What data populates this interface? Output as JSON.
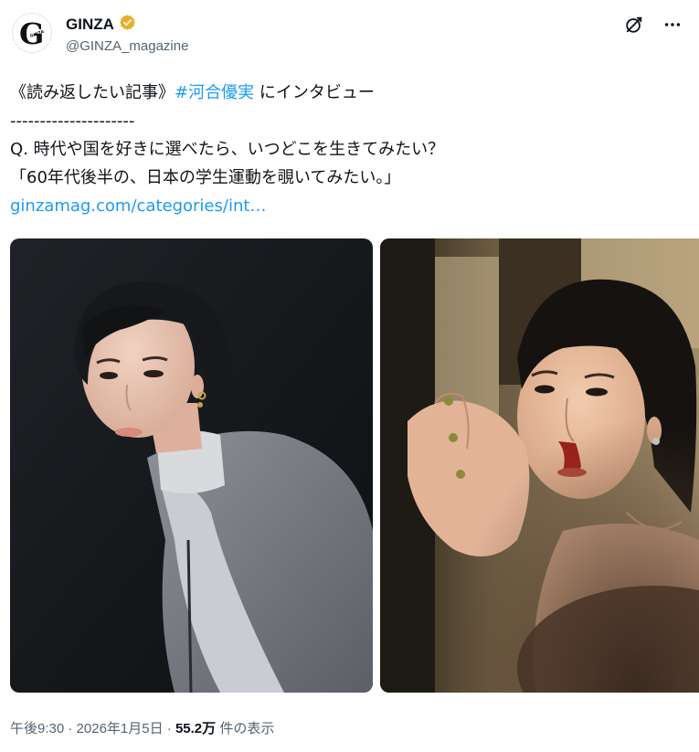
{
  "account": {
    "avatar_letter": "G",
    "avatar_wordmark": "GINZA",
    "display_name": "GINZA",
    "handle": "@GINZA_magazine",
    "verified_color": "#e8b02a"
  },
  "tweet": {
    "line1_prefix": "《読み返したい記事》",
    "hashtag": "#河合優実",
    "line1_suffix": " にインタビュー",
    "separator": "---------------------",
    "question": "Q. 時代や国を好きに選べたら、いつどこを生きてみたい？",
    "answer": "「60年代後半の、日本の学生運動を覗いてみたい。」",
    "link": "ginzamag.com/categories/int…"
  },
  "media": {
    "left_image": "portrait-photo",
    "right_image": "film-still-photo"
  },
  "meta": {
    "time": "午後9:30",
    "dot": " · ",
    "date": "2026年1月5日",
    "views_count": "55.2万",
    "views_label": " 件の表示"
  },
  "icons": [
    "grok-icon",
    "more-icon",
    "verified-badge-icon"
  ],
  "colors": {
    "accent": "#1d9bf0",
    "secondary_text": "#536471",
    "text": "#0f1419"
  }
}
